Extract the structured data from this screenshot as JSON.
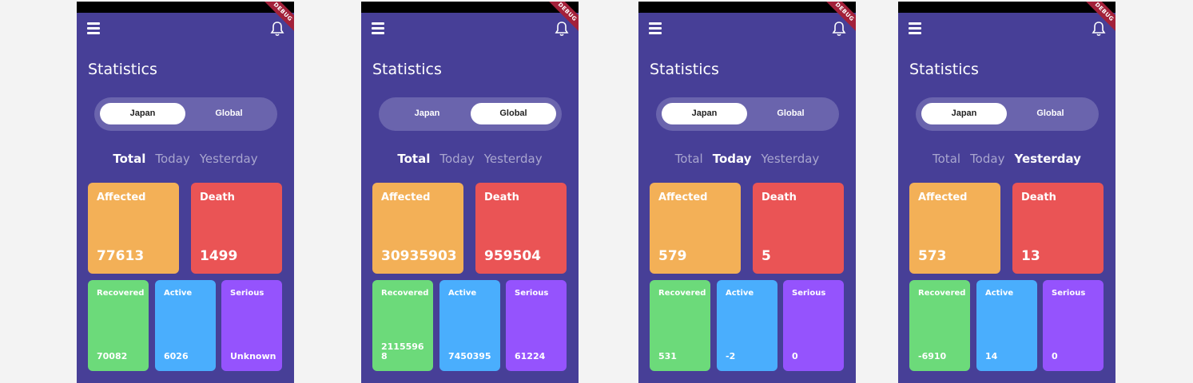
{
  "screens": [
    {
      "debug_label": "DEBUG",
      "title": "Statistics",
      "toggle": {
        "left": "Japan",
        "right": "Global",
        "selected": "left"
      },
      "tabs": {
        "total": "Total",
        "today": "Today",
        "yesterday": "Yesterday",
        "selected": "total"
      },
      "stats": {
        "affected_label": "Affected",
        "affected_value": "77613",
        "death_label": "Death",
        "death_value": "1499",
        "recovered_label": "Recovered",
        "recovered_value": "70082",
        "active_label": "Active",
        "active_value": "6026",
        "serious_label": "Serious",
        "serious_value": "Unknown"
      }
    },
    {
      "debug_label": "DEBUG",
      "title": "Statistics",
      "toggle": {
        "left": "Japan",
        "right": "Global",
        "selected": "right"
      },
      "tabs": {
        "total": "Total",
        "today": "Today",
        "yesterday": "Yesterday",
        "selected": "total"
      },
      "stats": {
        "affected_label": "Affected",
        "affected_value": "30935903",
        "death_label": "Death",
        "death_value": "959504",
        "recovered_label": "Recovered",
        "recovered_value": "21155968",
        "active_label": "Active",
        "active_value": "7450395",
        "serious_label": "Serious",
        "serious_value": "61224"
      }
    },
    {
      "debug_label": "DEBUG",
      "title": "Statistics",
      "toggle": {
        "left": "Japan",
        "right": "Global",
        "selected": "left"
      },
      "tabs": {
        "total": "Total",
        "today": "Today",
        "yesterday": "Yesterday",
        "selected": "today"
      },
      "stats": {
        "affected_label": "Affected",
        "affected_value": "579",
        "death_label": "Death",
        "death_value": "5",
        "recovered_label": "Recovered",
        "recovered_value": "531",
        "active_label": "Active",
        "active_value": "-2",
        "serious_label": "Serious",
        "serious_value": "0"
      }
    },
    {
      "debug_label": "DEBUG",
      "title": "Statistics",
      "toggle": {
        "left": "Japan",
        "right": "Global",
        "selected": "left"
      },
      "tabs": {
        "total": "Total",
        "today": "Today",
        "yesterday": "Yesterday",
        "selected": "yesterday"
      },
      "stats": {
        "affected_label": "Affected",
        "affected_value": "573",
        "death_label": "Death",
        "death_value": "13",
        "recovered_label": "Recovered",
        "recovered_value": "-6910",
        "active_label": "Active",
        "active_value": "14",
        "serious_label": "Serious",
        "serious_value": "0"
      }
    }
  ]
}
